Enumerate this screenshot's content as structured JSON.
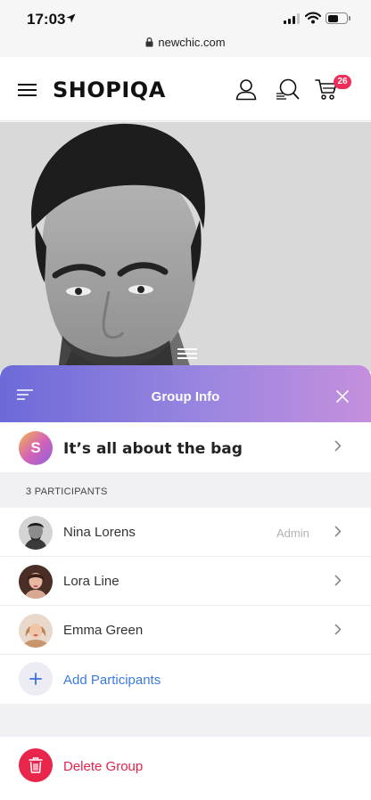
{
  "status_bar": {
    "time": "17:03",
    "url": "newchic.com"
  },
  "header": {
    "logo": "SHOPIQA",
    "cart_count": "26"
  },
  "sheet": {
    "title": "Group Info",
    "group": {
      "avatar_letter": "S",
      "name": "It’s all about the bag"
    },
    "participants_label": "3 PARTICIPANTS",
    "participants": [
      {
        "name": "Nina Lorens",
        "role": "Admin"
      },
      {
        "name": "Lora Line",
        "role": ""
      },
      {
        "name": "Emma Green",
        "role": ""
      }
    ],
    "add_label": "Add Participants",
    "delete_label": "Delete Group"
  },
  "colors": {
    "accent": "#3b7be4",
    "danger": "#e8264c",
    "badge": "#ef2d56",
    "header_gradient_start": "#6c6ad8",
    "header_gradient_end": "#c58fde"
  },
  "icons": [
    "location-arrow-icon",
    "signal-icon",
    "wifi-icon",
    "battery-icon",
    "lock-icon",
    "menu-icon",
    "user-icon",
    "search-icon",
    "cart-icon",
    "close-icon",
    "chevron-right-icon",
    "plus-icon",
    "trash-icon"
  ]
}
